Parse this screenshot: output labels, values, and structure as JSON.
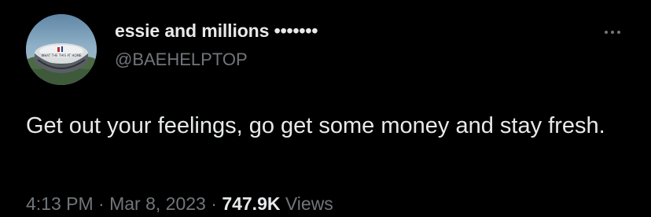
{
  "author": {
    "display_name": "essie and millions •••••••",
    "handle": "@BAEHELPTOP",
    "avatar_icon": "stadium-photo-avatar"
  },
  "more_icon": "ellipsis-icon",
  "tweet": {
    "text": "Get out your feelings, go get some money and stay fresh."
  },
  "meta": {
    "time": "4:13 PM",
    "sep1": " · ",
    "date": "Mar 8, 2023",
    "sep2": " · ",
    "views_count": "747.9K",
    "views_label": " Views"
  },
  "colors": {
    "background": "#000000",
    "primary_text": "#e7e9ea",
    "secondary_text": "#71767b"
  }
}
